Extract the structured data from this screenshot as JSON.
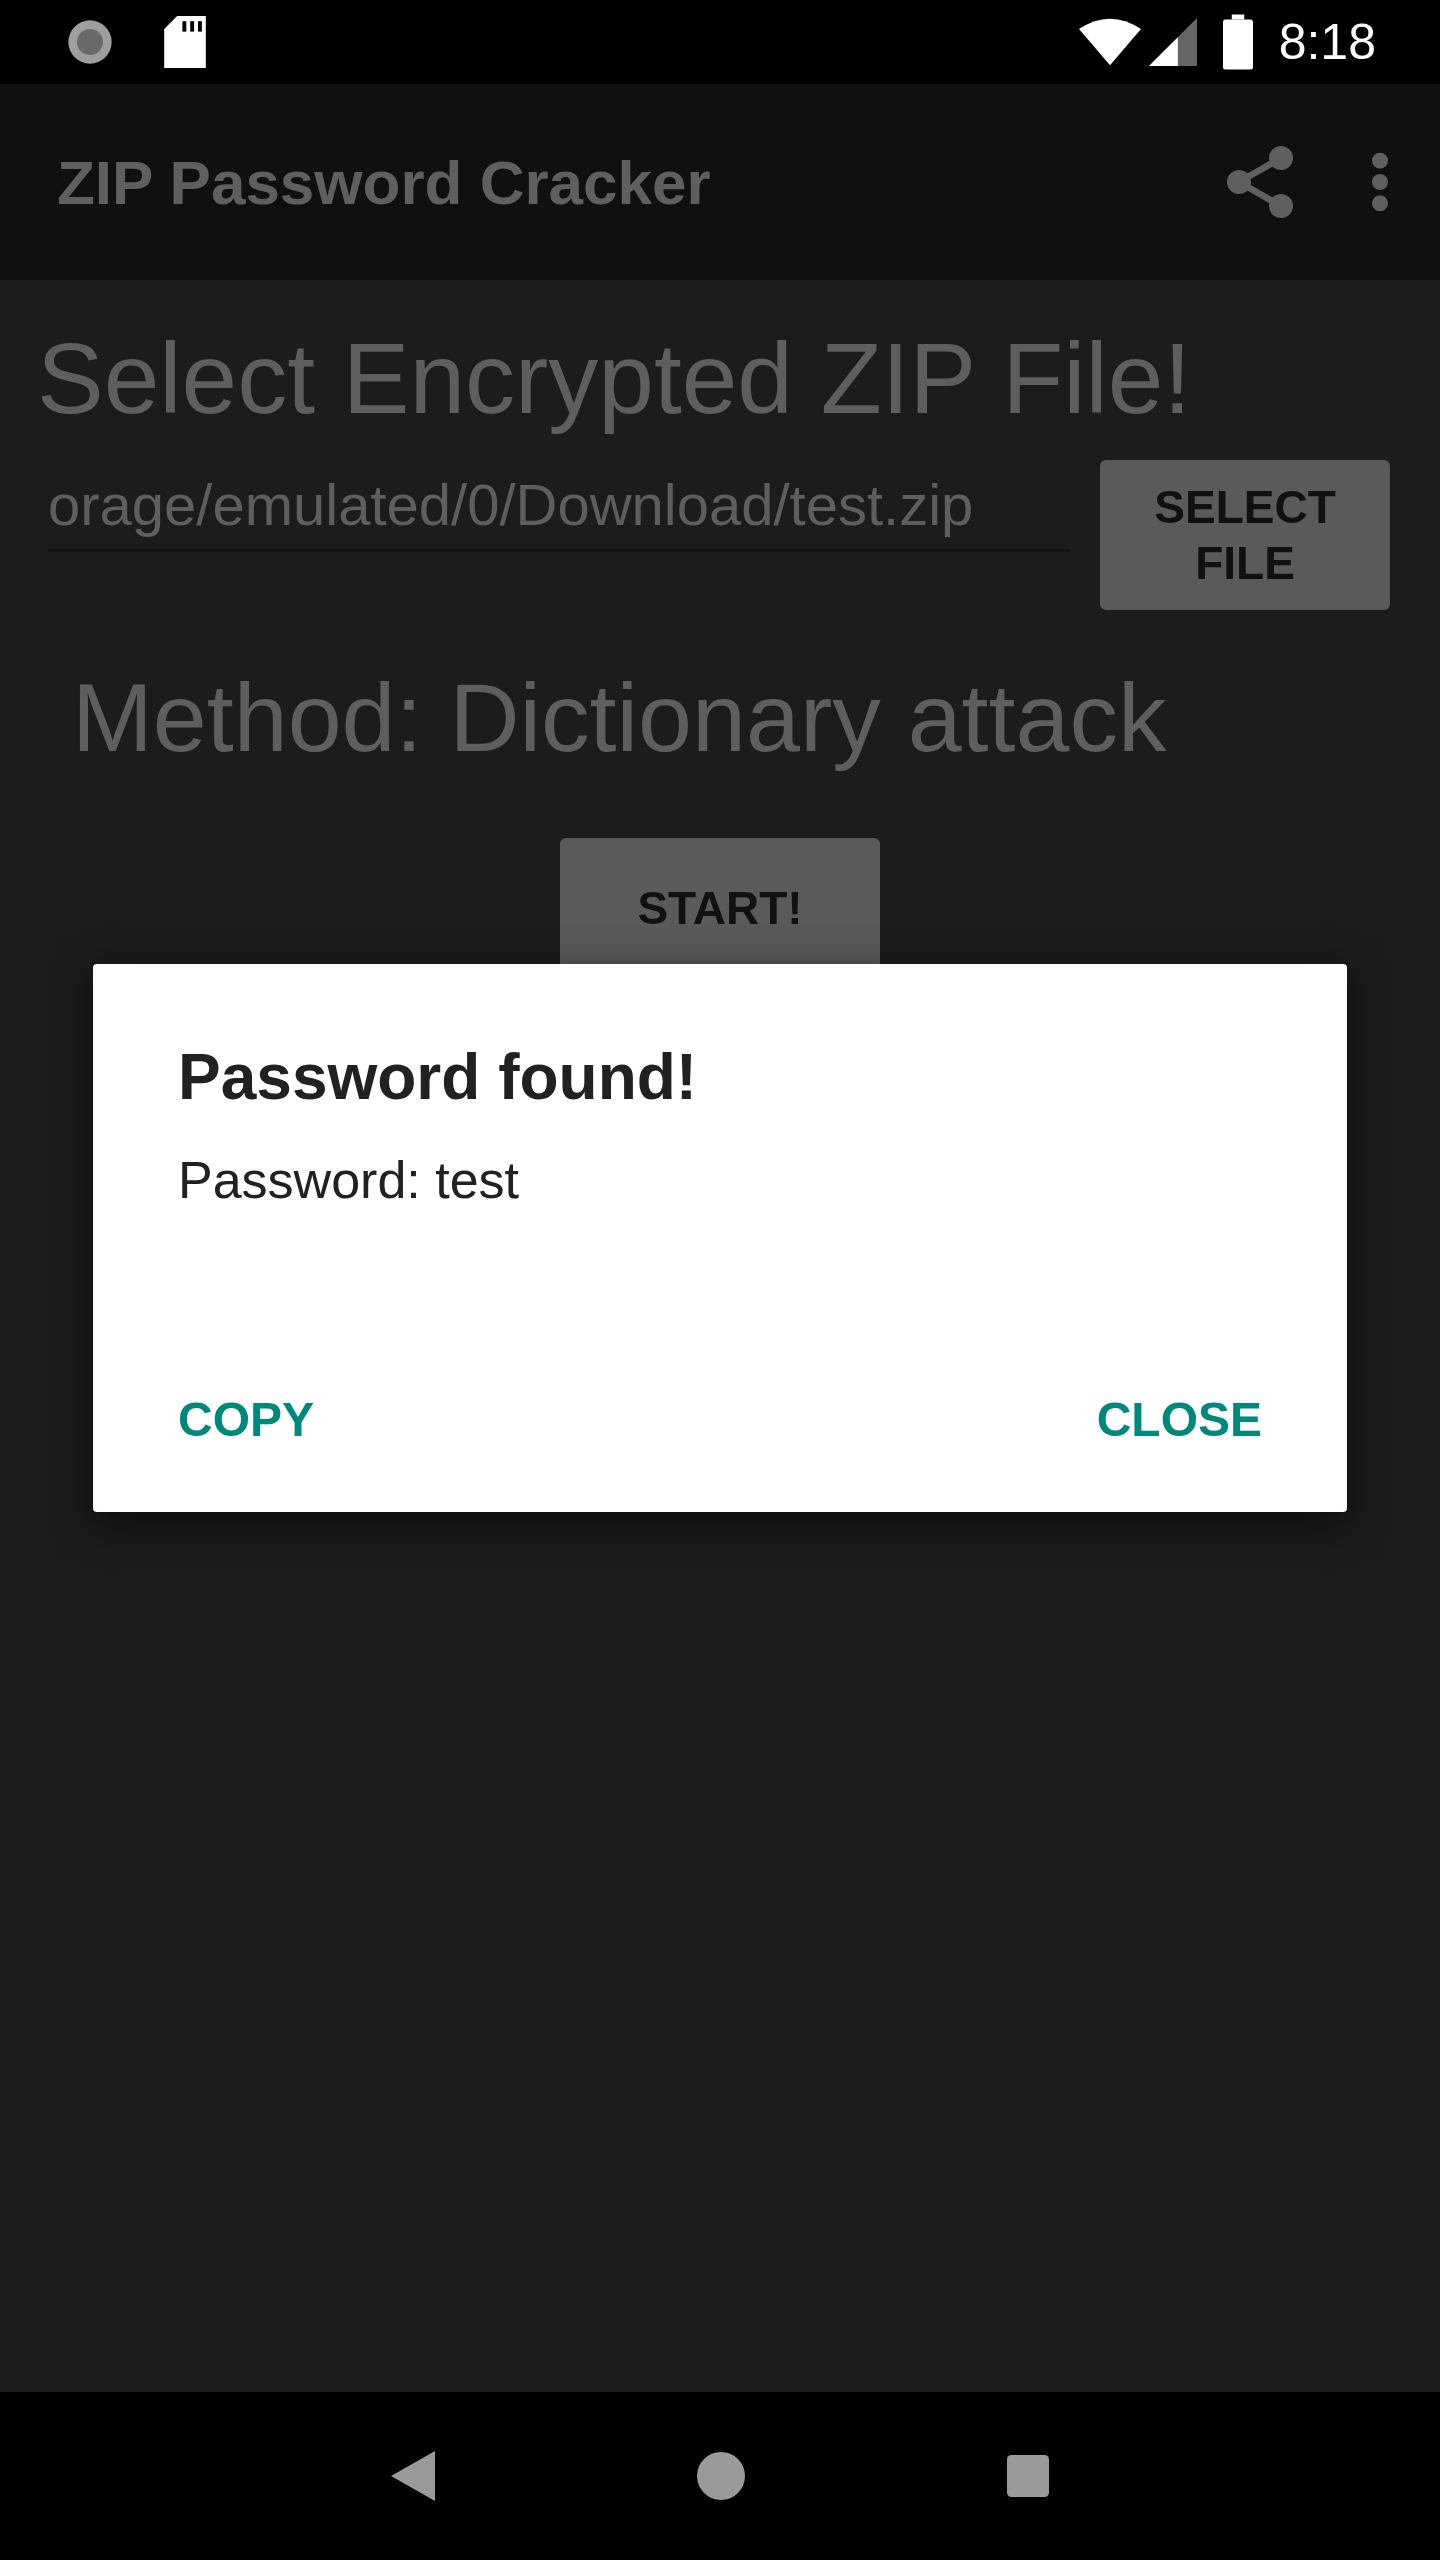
{
  "status_bar": {
    "time": "8:18"
  },
  "app_bar": {
    "title": "ZIP Password Cracker"
  },
  "heading": "Select Encrypted ZIP File!",
  "file_field": {
    "value": "orage/emulated/0/Download/test.zip"
  },
  "select_button": "SELECT FILE",
  "method": "Method: Dictionary attack",
  "start_button": "START!",
  "dialog": {
    "title": "Password found!",
    "message": "Password: test",
    "buttons": [
      {
        "label": "COPY"
      },
      {
        "label": "CLOSE"
      }
    ]
  }
}
